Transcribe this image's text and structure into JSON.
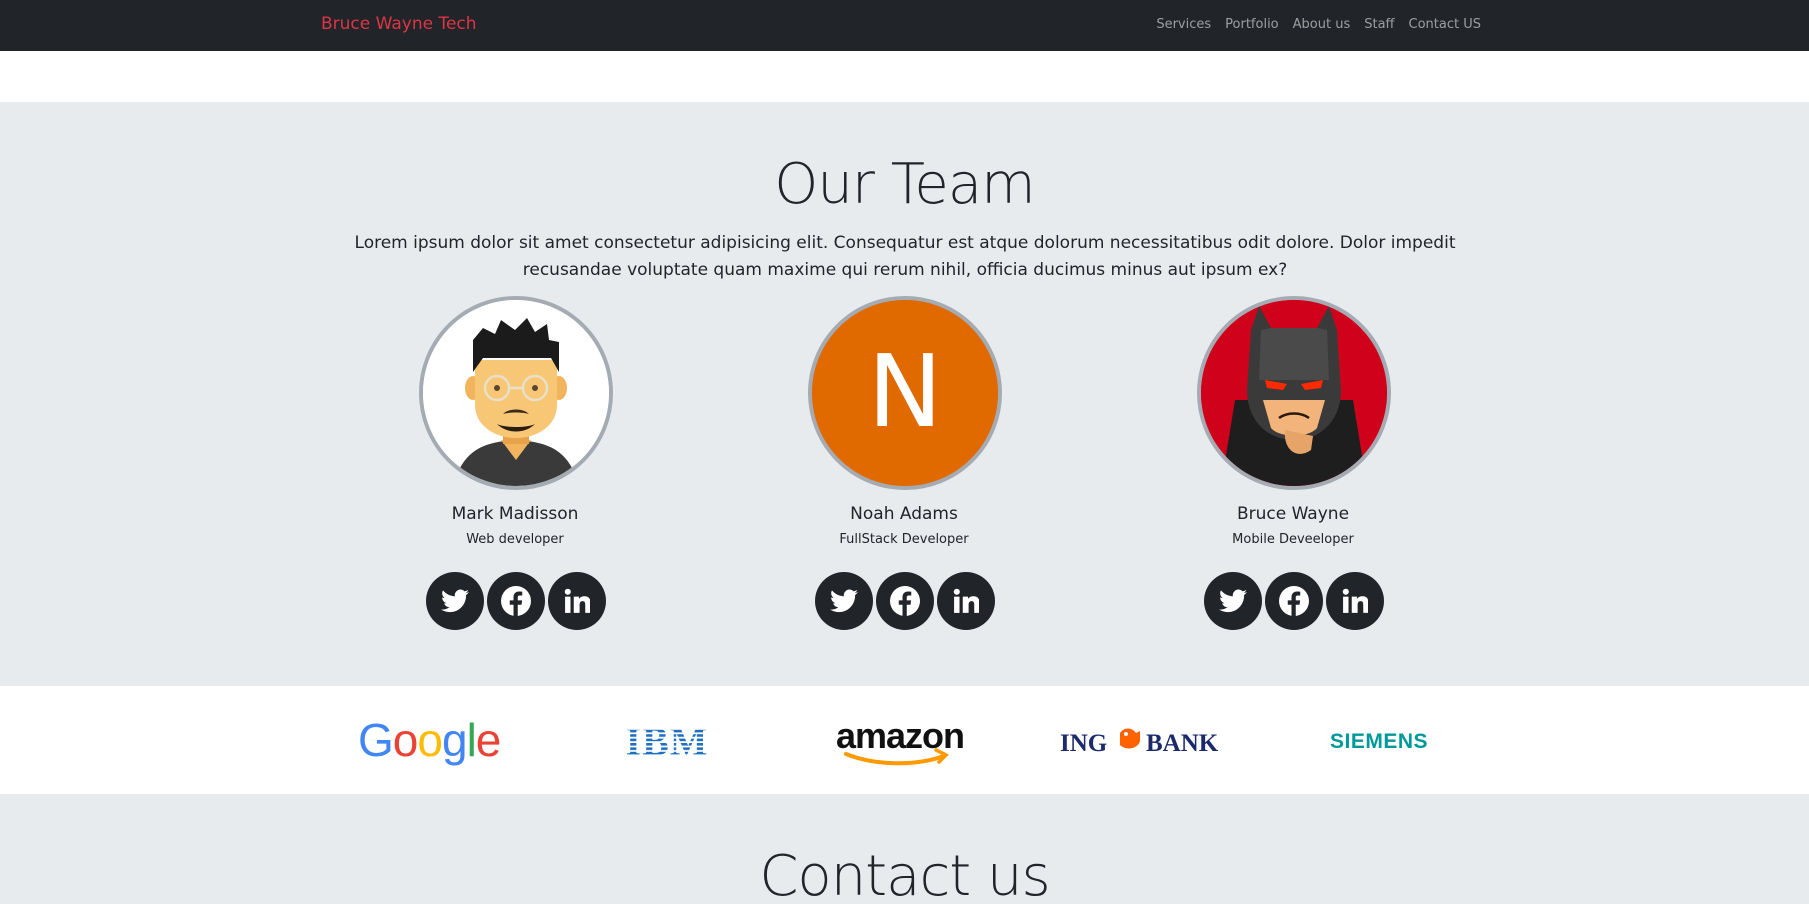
{
  "navbar": {
    "brand": "Bruce Wayne Tech",
    "links": [
      "Services",
      "Portfolio",
      "About us",
      "Staff",
      "Contact US"
    ]
  },
  "team": {
    "title": "Our Team",
    "description": "Lorem ipsum dolor sit amet consectetur adipisicing elit. Consequatur est atque dolorum necessitatibus odit dolore. Dolor impedit recusandae voluptate quam maxime qui rerum nihil, officia ducimus minus aut ipsum ex?",
    "members": [
      {
        "name": "Mark Madisson",
        "role": "Web developer",
        "avatar_icon": "cartoon-man-glasses-avatar"
      },
      {
        "name": "Noah Adams",
        "role": "FullStack Developer",
        "avatar_letter": "N",
        "avatar_color": "#e06a00"
      },
      {
        "name": "Bruce Wayne",
        "role": "Mobile Deveeloper",
        "avatar_icon": "batman-avatar"
      }
    ],
    "social_icons": [
      "twitter-icon",
      "facebook-icon",
      "linkedin-icon"
    ]
  },
  "logos": {
    "google": "Google",
    "ibm": "IBM",
    "amazon": "amazon",
    "ing": "ING",
    "ing_bank": "BANK",
    "siemens": "SIEMENS"
  },
  "contact": {
    "title": "Contact us"
  },
  "colors": {
    "navbar_bg": "#212529",
    "brand": "#dc3545",
    "section_bg": "#e8ebee",
    "social_bg": "#212529"
  }
}
